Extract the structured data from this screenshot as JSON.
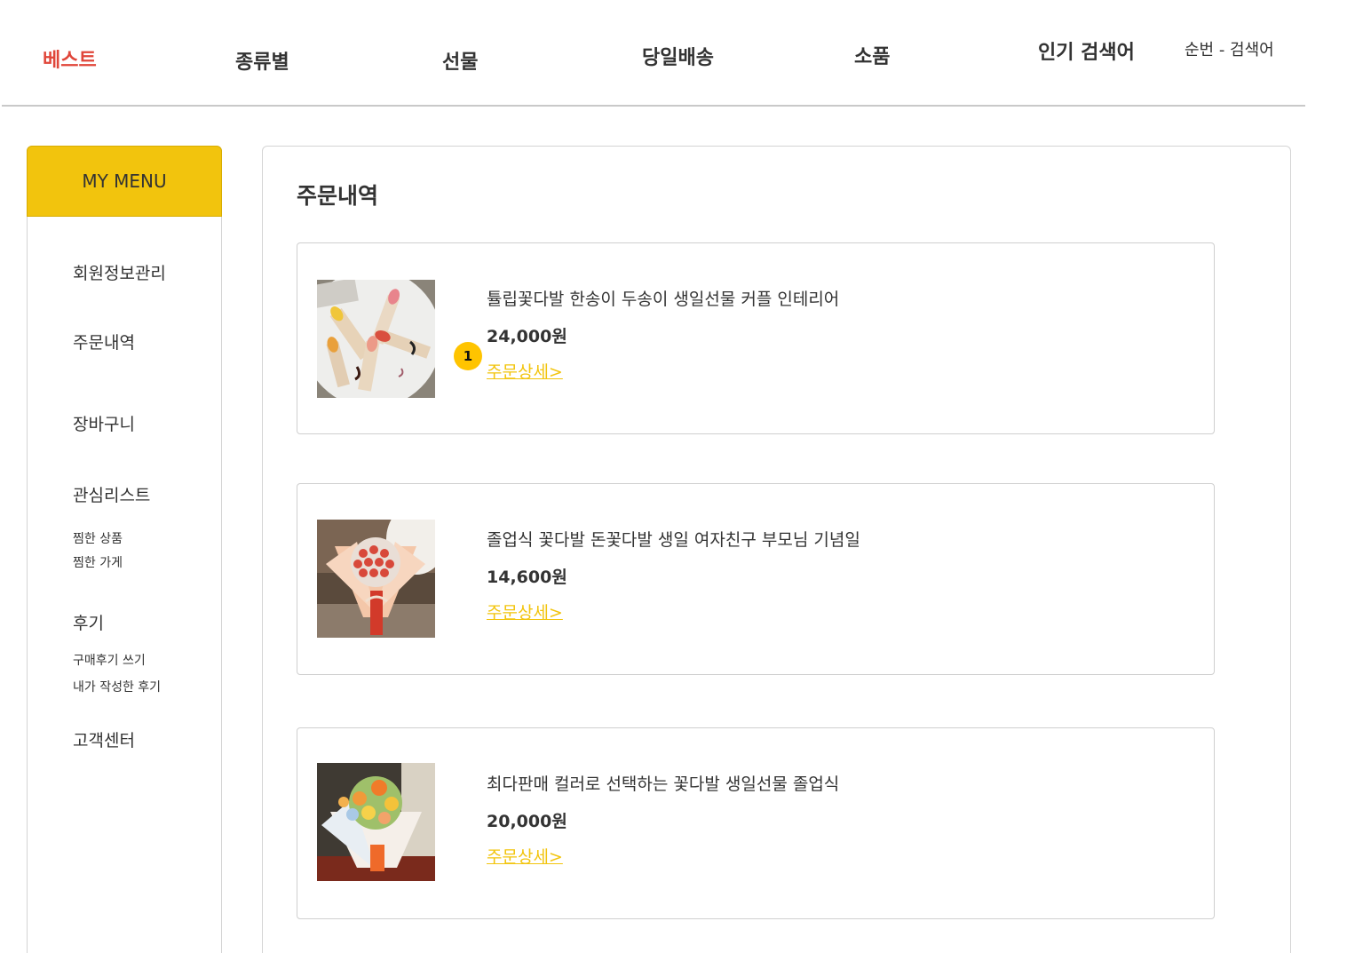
{
  "nav": {
    "best": "베스트",
    "by_type": "종류별",
    "gift": "선물",
    "same_day": "당일배송",
    "small_items": "소품",
    "popular": "인기 검색어",
    "rank_text": "순번 - 검색어",
    "active_color": "#e0463a"
  },
  "sidebar": {
    "header": "MY MENU",
    "member_info": "회원정보관리",
    "orders": "주문내역",
    "cart": "장바구니",
    "wishlist": "관심리스트",
    "wish_products": "찜한 상품",
    "wish_stores": "찜한 가게",
    "reviews": "후기",
    "write_review": "구매후기 쓰기",
    "my_reviews": "내가 작성한 후기",
    "support": "고객센터",
    "accent_color": "#f2c40d"
  },
  "main": {
    "title": "주문내역",
    "detail_label": "주문상세>",
    "badge": "1",
    "orders": [
      {
        "name": "튤립꽃다발 한송이 두송이 생일선물 커플 인테리어",
        "price": "24,000원",
        "image": "tulip-bouquets-photo"
      },
      {
        "name": "졸업식 꽃다발 돈꽃다발 생일 여자친구 부모님 기념일",
        "price": "14,600원",
        "image": "rose-bouquet-photo"
      },
      {
        "name": "최다판매 컬러로 선택하는 꽃다발 생일선물 졸업식",
        "price": "20,000원",
        "image": "mixed-bouquet-photo"
      }
    ]
  }
}
